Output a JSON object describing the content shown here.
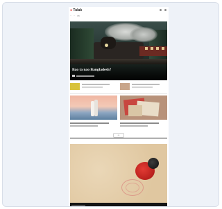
{
  "site": {
    "logo_prefix": "● ",
    "logo_text": "Tulak"
  },
  "nav": {
    "items": [
      "—",
      "—",
      "—"
    ]
  },
  "hero": {
    "title": "Bao ta nao Bangladesh?",
    "image_icon": "steam-train-image"
  },
  "pagination": {
    "load_more_label": "•••"
  },
  "section": {
    "title": "",
    "link": ""
  },
  "colors": {
    "brand": "#e2231a",
    "dark": "#151515",
    "paper": "#e4cda8"
  },
  "icons": [
    "search-icon",
    "menu-icon",
    "stamp-image",
    "couple-beach-image",
    "letters-image"
  ]
}
